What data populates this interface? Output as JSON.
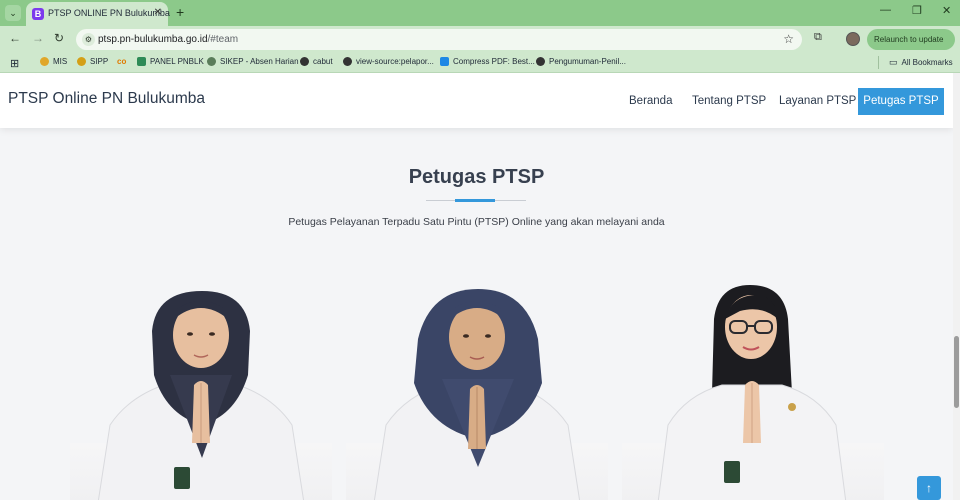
{
  "browser": {
    "tab_title": "PTSP ONLINE PN Bulukumba",
    "tab_favicon_letter": "B",
    "url_host": "ptsp.pn-bulukumba.go.id",
    "url_path": "/#team",
    "relaunch_label": "Relaunch to update",
    "bookmarks": [
      "MIS",
      "SIPP",
      "PANEL PNBLK",
      "SIKEP - Absen Harian",
      "cabut",
      "view-source:pelapor...",
      "Compress PDF: Best...",
      "Pengumuman-Penil..."
    ],
    "all_bookmarks_label": "All Bookmarks"
  },
  "site": {
    "brand": "PTSP Online PN Bulukumba",
    "nav": [
      "Beranda",
      "Tentang PTSP",
      "Layanan PTSP",
      "Petugas PTSP"
    ],
    "accent_color": "#3498db"
  },
  "team": {
    "title": "Petugas PTSP",
    "subtitle": "Petugas Pelayanan Terpadu Satu Pintu (PTSP) Online yang akan melayani anda"
  }
}
